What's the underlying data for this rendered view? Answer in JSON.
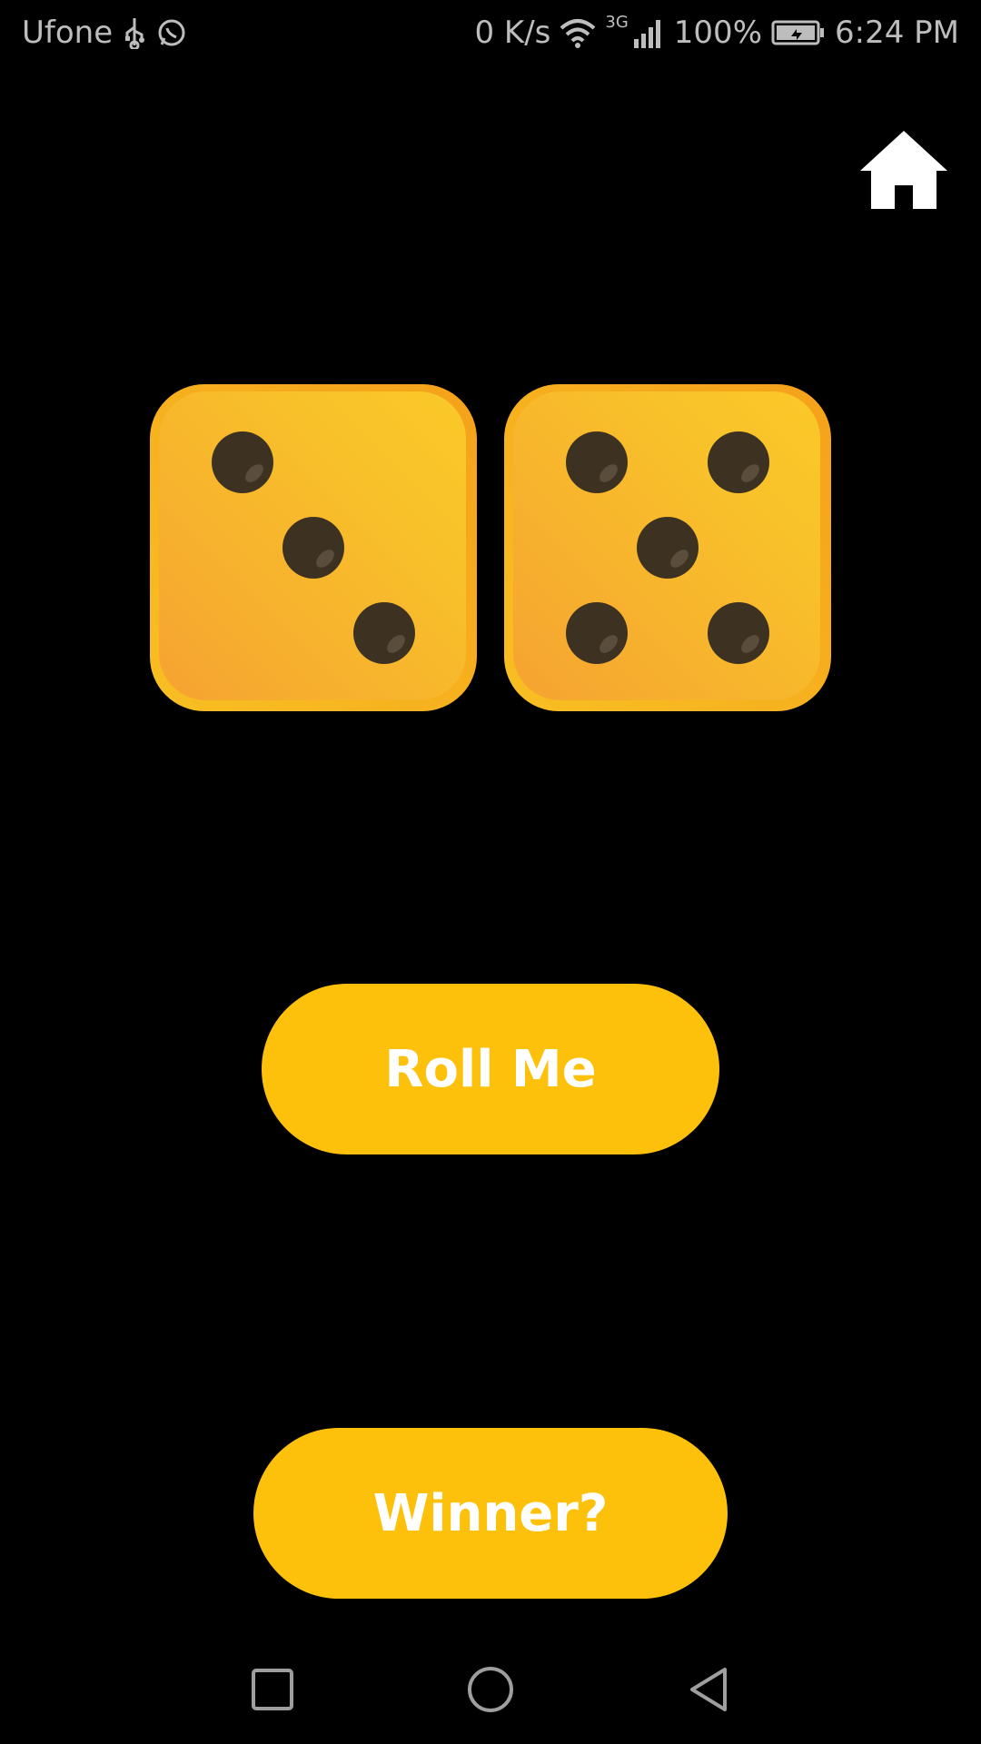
{
  "status_bar": {
    "carrier": "Ufone",
    "network_speed": "0 K/s",
    "network_gen": "3G",
    "battery": "100%",
    "time": "6:24 PM"
  },
  "dice": [
    {
      "value": 3
    },
    {
      "value": 5
    }
  ],
  "buttons": {
    "roll_label": "Roll Me",
    "winner_label": "Winner?"
  },
  "colors": {
    "background": "#000000",
    "button": "#fdc10c",
    "die_face": "#f8bf22",
    "pip": "#3d3222"
  },
  "icons": {
    "home": "home-icon",
    "nav_recents": "square-icon",
    "nav_home": "circle-icon",
    "nav_back": "triangle-back-icon"
  }
}
